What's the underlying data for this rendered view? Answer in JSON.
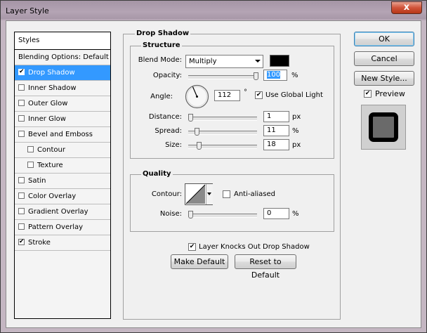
{
  "window": {
    "title": "Layer Style",
    "close_glyph": "x"
  },
  "styles": {
    "header": "Styles",
    "blending": "Blending Options: Default",
    "items": [
      {
        "label": "Drop Shadow",
        "checked": true,
        "selected": true,
        "indent": false
      },
      {
        "label": "Inner Shadow",
        "checked": false,
        "selected": false,
        "indent": false
      },
      {
        "label": "Outer Glow",
        "checked": false,
        "selected": false,
        "indent": false
      },
      {
        "label": "Inner Glow",
        "checked": false,
        "selected": false,
        "indent": false
      },
      {
        "label": "Bevel and Emboss",
        "checked": false,
        "selected": false,
        "indent": false
      },
      {
        "label": "Contour",
        "checked": false,
        "selected": false,
        "indent": true
      },
      {
        "label": "Texture",
        "checked": false,
        "selected": false,
        "indent": true
      },
      {
        "label": "Satin",
        "checked": false,
        "selected": false,
        "indent": false
      },
      {
        "label": "Color Overlay",
        "checked": false,
        "selected": false,
        "indent": false
      },
      {
        "label": "Gradient Overlay",
        "checked": false,
        "selected": false,
        "indent": false
      },
      {
        "label": "Pattern Overlay",
        "checked": false,
        "selected": false,
        "indent": false
      },
      {
        "label": "Stroke",
        "checked": true,
        "selected": false,
        "indent": false
      }
    ]
  },
  "drop_shadow": {
    "title": "Drop Shadow",
    "structure": {
      "title": "Structure",
      "blend_mode_label": "Blend Mode:",
      "blend_mode_value": "Multiply",
      "shadow_color": "#000000",
      "opacity_label": "Opacity:",
      "opacity_value": "100",
      "opacity_unit": "%",
      "angle_label": "Angle:",
      "angle_value": "112",
      "angle_unit": "°",
      "use_global_light_label": "Use Global Light",
      "use_global_light": true,
      "distance_label": "Distance:",
      "distance_value": "1",
      "distance_unit": "px",
      "spread_label": "Spread:",
      "spread_value": "11",
      "spread_unit": "%",
      "size_label": "Size:",
      "size_value": "18",
      "size_unit": "px"
    },
    "quality": {
      "title": "Quality",
      "contour_label": "Contour:",
      "anti_aliased_label": "Anti-aliased",
      "anti_aliased": false,
      "noise_label": "Noise:",
      "noise_value": "0",
      "noise_unit": "%"
    },
    "knocks_out_label": "Layer Knocks Out Drop Shadow",
    "knocks_out": true,
    "make_default_label": "Make Default",
    "reset_default_label": "Reset to Default"
  },
  "actions": {
    "ok_label": "OK",
    "cancel_label": "Cancel",
    "new_style_label": "New Style...",
    "preview_label": "Preview",
    "preview_checked": true
  },
  "colors": {
    "selection": "#3399ff",
    "dialog_bg": "#f0f0f0"
  }
}
